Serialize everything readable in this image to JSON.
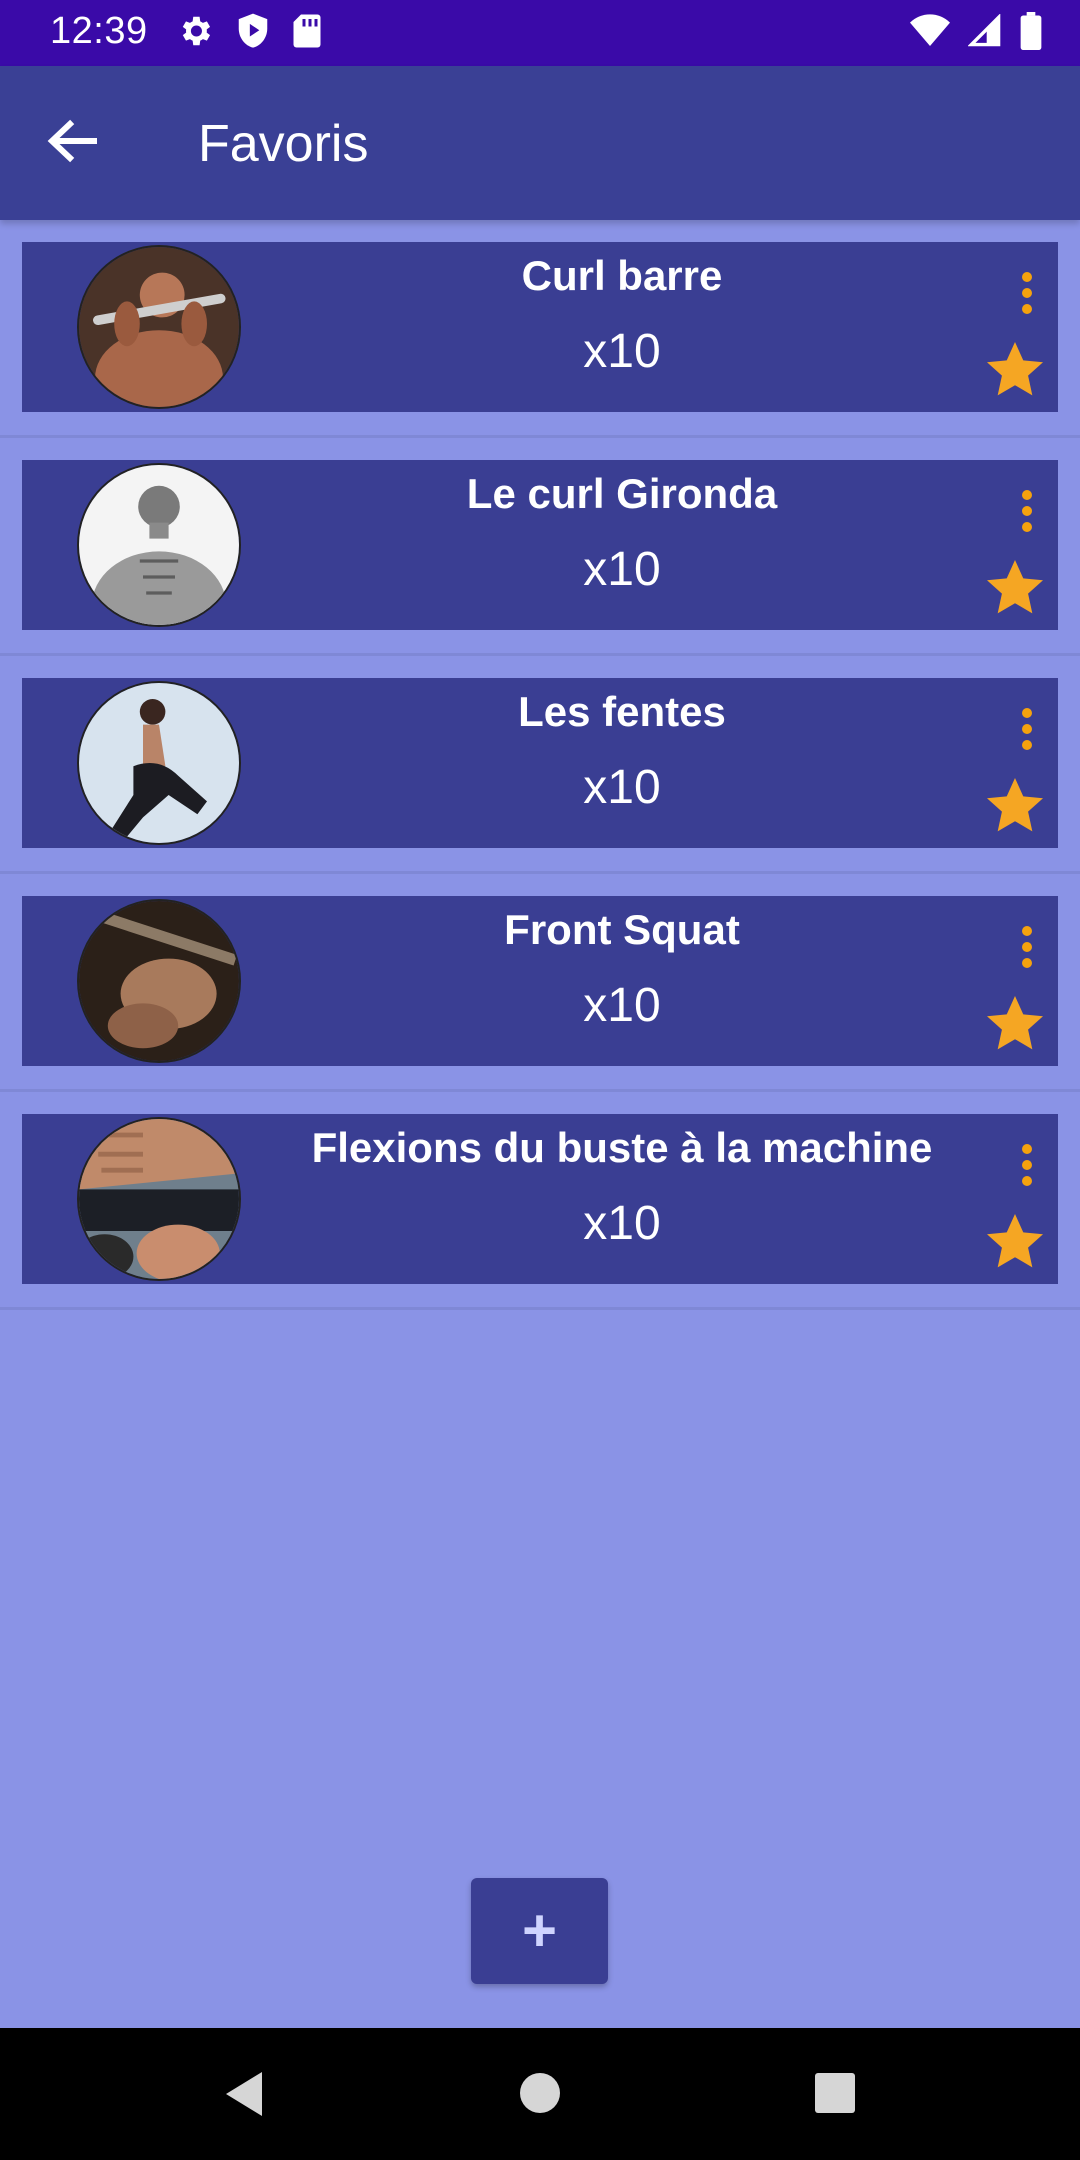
{
  "status_bar": {
    "time": "12:39",
    "left_icons": [
      "gear-icon",
      "shield-play-icon",
      "sd-card-icon"
    ],
    "right_icons": [
      "wifi-icon",
      "signal-icon",
      "battery-icon"
    ]
  },
  "app_bar": {
    "title": "Favoris",
    "back_icon": "arrow-left-icon",
    "color": "#3a4095"
  },
  "exercises": [
    {
      "name": "Curl barre",
      "reps": "x10",
      "favorite": true
    },
    {
      "name": "Le curl Gironda",
      "reps": "x10",
      "favorite": true
    },
    {
      "name": "Les fentes",
      "reps": "x10",
      "favorite": true
    },
    {
      "name": "Front Squat",
      "reps": "x10",
      "favorite": true
    },
    {
      "name": "Flexions du buste à la machine",
      "reps": "x10",
      "favorite": true
    }
  ],
  "fab": {
    "label": "+",
    "icon": "plus-icon"
  },
  "colors": {
    "background": "#8a93e6",
    "card": "#3a3e93",
    "accent_star": "#f5a623",
    "accent_dots": "#f5a20e",
    "status_bar": "#3a0aa8"
  },
  "nav_bar": {
    "icons": [
      "triangle-back-icon",
      "circle-home-icon",
      "square-recents-icon"
    ]
  }
}
